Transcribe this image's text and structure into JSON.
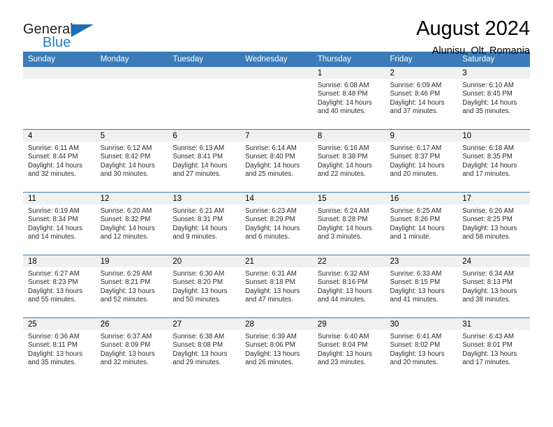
{
  "brand": {
    "name_part1": "General",
    "name_part2": "Blue",
    "logo_icon": "triangle-flag-icon"
  },
  "header": {
    "title": "August 2024",
    "subtitle": "Alunisu, Olt, Romania"
  },
  "calendar": {
    "weekday_headers": [
      "Sunday",
      "Monday",
      "Tuesday",
      "Wednesday",
      "Thursday",
      "Friday",
      "Saturday"
    ],
    "accent_color": "#3b7cb8",
    "daynum_background": "#f0f0f0",
    "weeks": [
      [
        {
          "day": "",
          "sunrise": "",
          "sunset": "",
          "daylight": "",
          "empty": true
        },
        {
          "day": "",
          "sunrise": "",
          "sunset": "",
          "daylight": "",
          "empty": true
        },
        {
          "day": "",
          "sunrise": "",
          "sunset": "",
          "daylight": "",
          "empty": true
        },
        {
          "day": "",
          "sunrise": "",
          "sunset": "",
          "daylight": "",
          "empty": true
        },
        {
          "day": "1",
          "sunrise": "Sunrise: 6:08 AM",
          "sunset": "Sunset: 8:48 PM",
          "daylight": "Daylight: 14 hours and 40 minutes."
        },
        {
          "day": "2",
          "sunrise": "Sunrise: 6:09 AM",
          "sunset": "Sunset: 8:46 PM",
          "daylight": "Daylight: 14 hours and 37 minutes."
        },
        {
          "day": "3",
          "sunrise": "Sunrise: 6:10 AM",
          "sunset": "Sunset: 8:45 PM",
          "daylight": "Daylight: 14 hours and 35 minutes."
        }
      ],
      [
        {
          "day": "4",
          "sunrise": "Sunrise: 6:11 AM",
          "sunset": "Sunset: 8:44 PM",
          "daylight": "Daylight: 14 hours and 32 minutes."
        },
        {
          "day": "5",
          "sunrise": "Sunrise: 6:12 AM",
          "sunset": "Sunset: 8:42 PM",
          "daylight": "Daylight: 14 hours and 30 minutes."
        },
        {
          "day": "6",
          "sunrise": "Sunrise: 6:13 AM",
          "sunset": "Sunset: 8:41 PM",
          "daylight": "Daylight: 14 hours and 27 minutes."
        },
        {
          "day": "7",
          "sunrise": "Sunrise: 6:14 AM",
          "sunset": "Sunset: 8:40 PM",
          "daylight": "Daylight: 14 hours and 25 minutes."
        },
        {
          "day": "8",
          "sunrise": "Sunrise: 6:16 AM",
          "sunset": "Sunset: 8:38 PM",
          "daylight": "Daylight: 14 hours and 22 minutes."
        },
        {
          "day": "9",
          "sunrise": "Sunrise: 6:17 AM",
          "sunset": "Sunset: 8:37 PM",
          "daylight": "Daylight: 14 hours and 20 minutes."
        },
        {
          "day": "10",
          "sunrise": "Sunrise: 6:18 AM",
          "sunset": "Sunset: 8:35 PM",
          "daylight": "Daylight: 14 hours and 17 minutes."
        }
      ],
      [
        {
          "day": "11",
          "sunrise": "Sunrise: 6:19 AM",
          "sunset": "Sunset: 8:34 PM",
          "daylight": "Daylight: 14 hours and 14 minutes."
        },
        {
          "day": "12",
          "sunrise": "Sunrise: 6:20 AM",
          "sunset": "Sunset: 8:32 PM",
          "daylight": "Daylight: 14 hours and 12 minutes."
        },
        {
          "day": "13",
          "sunrise": "Sunrise: 6:21 AM",
          "sunset": "Sunset: 8:31 PM",
          "daylight": "Daylight: 14 hours and 9 minutes."
        },
        {
          "day": "14",
          "sunrise": "Sunrise: 6:23 AM",
          "sunset": "Sunset: 8:29 PM",
          "daylight": "Daylight: 14 hours and 6 minutes."
        },
        {
          "day": "15",
          "sunrise": "Sunrise: 6:24 AM",
          "sunset": "Sunset: 8:28 PM",
          "daylight": "Daylight: 14 hours and 3 minutes."
        },
        {
          "day": "16",
          "sunrise": "Sunrise: 6:25 AM",
          "sunset": "Sunset: 8:26 PM",
          "daylight": "Daylight: 14 hours and 1 minute."
        },
        {
          "day": "17",
          "sunrise": "Sunrise: 6:26 AM",
          "sunset": "Sunset: 8:25 PM",
          "daylight": "Daylight: 13 hours and 58 minutes."
        }
      ],
      [
        {
          "day": "18",
          "sunrise": "Sunrise: 6:27 AM",
          "sunset": "Sunset: 8:23 PM",
          "daylight": "Daylight: 13 hours and 55 minutes."
        },
        {
          "day": "19",
          "sunrise": "Sunrise: 6:29 AM",
          "sunset": "Sunset: 8:21 PM",
          "daylight": "Daylight: 13 hours and 52 minutes."
        },
        {
          "day": "20",
          "sunrise": "Sunrise: 6:30 AM",
          "sunset": "Sunset: 8:20 PM",
          "daylight": "Daylight: 13 hours and 50 minutes."
        },
        {
          "day": "21",
          "sunrise": "Sunrise: 6:31 AM",
          "sunset": "Sunset: 8:18 PM",
          "daylight": "Daylight: 13 hours and 47 minutes."
        },
        {
          "day": "22",
          "sunrise": "Sunrise: 6:32 AM",
          "sunset": "Sunset: 8:16 PM",
          "daylight": "Daylight: 13 hours and 44 minutes."
        },
        {
          "day": "23",
          "sunrise": "Sunrise: 6:33 AM",
          "sunset": "Sunset: 8:15 PM",
          "daylight": "Daylight: 13 hours and 41 minutes."
        },
        {
          "day": "24",
          "sunrise": "Sunrise: 6:34 AM",
          "sunset": "Sunset: 8:13 PM",
          "daylight": "Daylight: 13 hours and 38 minutes."
        }
      ],
      [
        {
          "day": "25",
          "sunrise": "Sunrise: 6:36 AM",
          "sunset": "Sunset: 8:11 PM",
          "daylight": "Daylight: 13 hours and 35 minutes."
        },
        {
          "day": "26",
          "sunrise": "Sunrise: 6:37 AM",
          "sunset": "Sunset: 8:09 PM",
          "daylight": "Daylight: 13 hours and 32 minutes."
        },
        {
          "day": "27",
          "sunrise": "Sunrise: 6:38 AM",
          "sunset": "Sunset: 8:08 PM",
          "daylight": "Daylight: 13 hours and 29 minutes."
        },
        {
          "day": "28",
          "sunrise": "Sunrise: 6:39 AM",
          "sunset": "Sunset: 8:06 PM",
          "daylight": "Daylight: 13 hours and 26 minutes."
        },
        {
          "day": "29",
          "sunrise": "Sunrise: 6:40 AM",
          "sunset": "Sunset: 8:04 PM",
          "daylight": "Daylight: 13 hours and 23 minutes."
        },
        {
          "day": "30",
          "sunrise": "Sunrise: 6:41 AM",
          "sunset": "Sunset: 8:02 PM",
          "daylight": "Daylight: 13 hours and 20 minutes."
        },
        {
          "day": "31",
          "sunrise": "Sunrise: 6:43 AM",
          "sunset": "Sunset: 8:01 PM",
          "daylight": "Daylight: 13 hours and 17 minutes."
        }
      ]
    ]
  }
}
